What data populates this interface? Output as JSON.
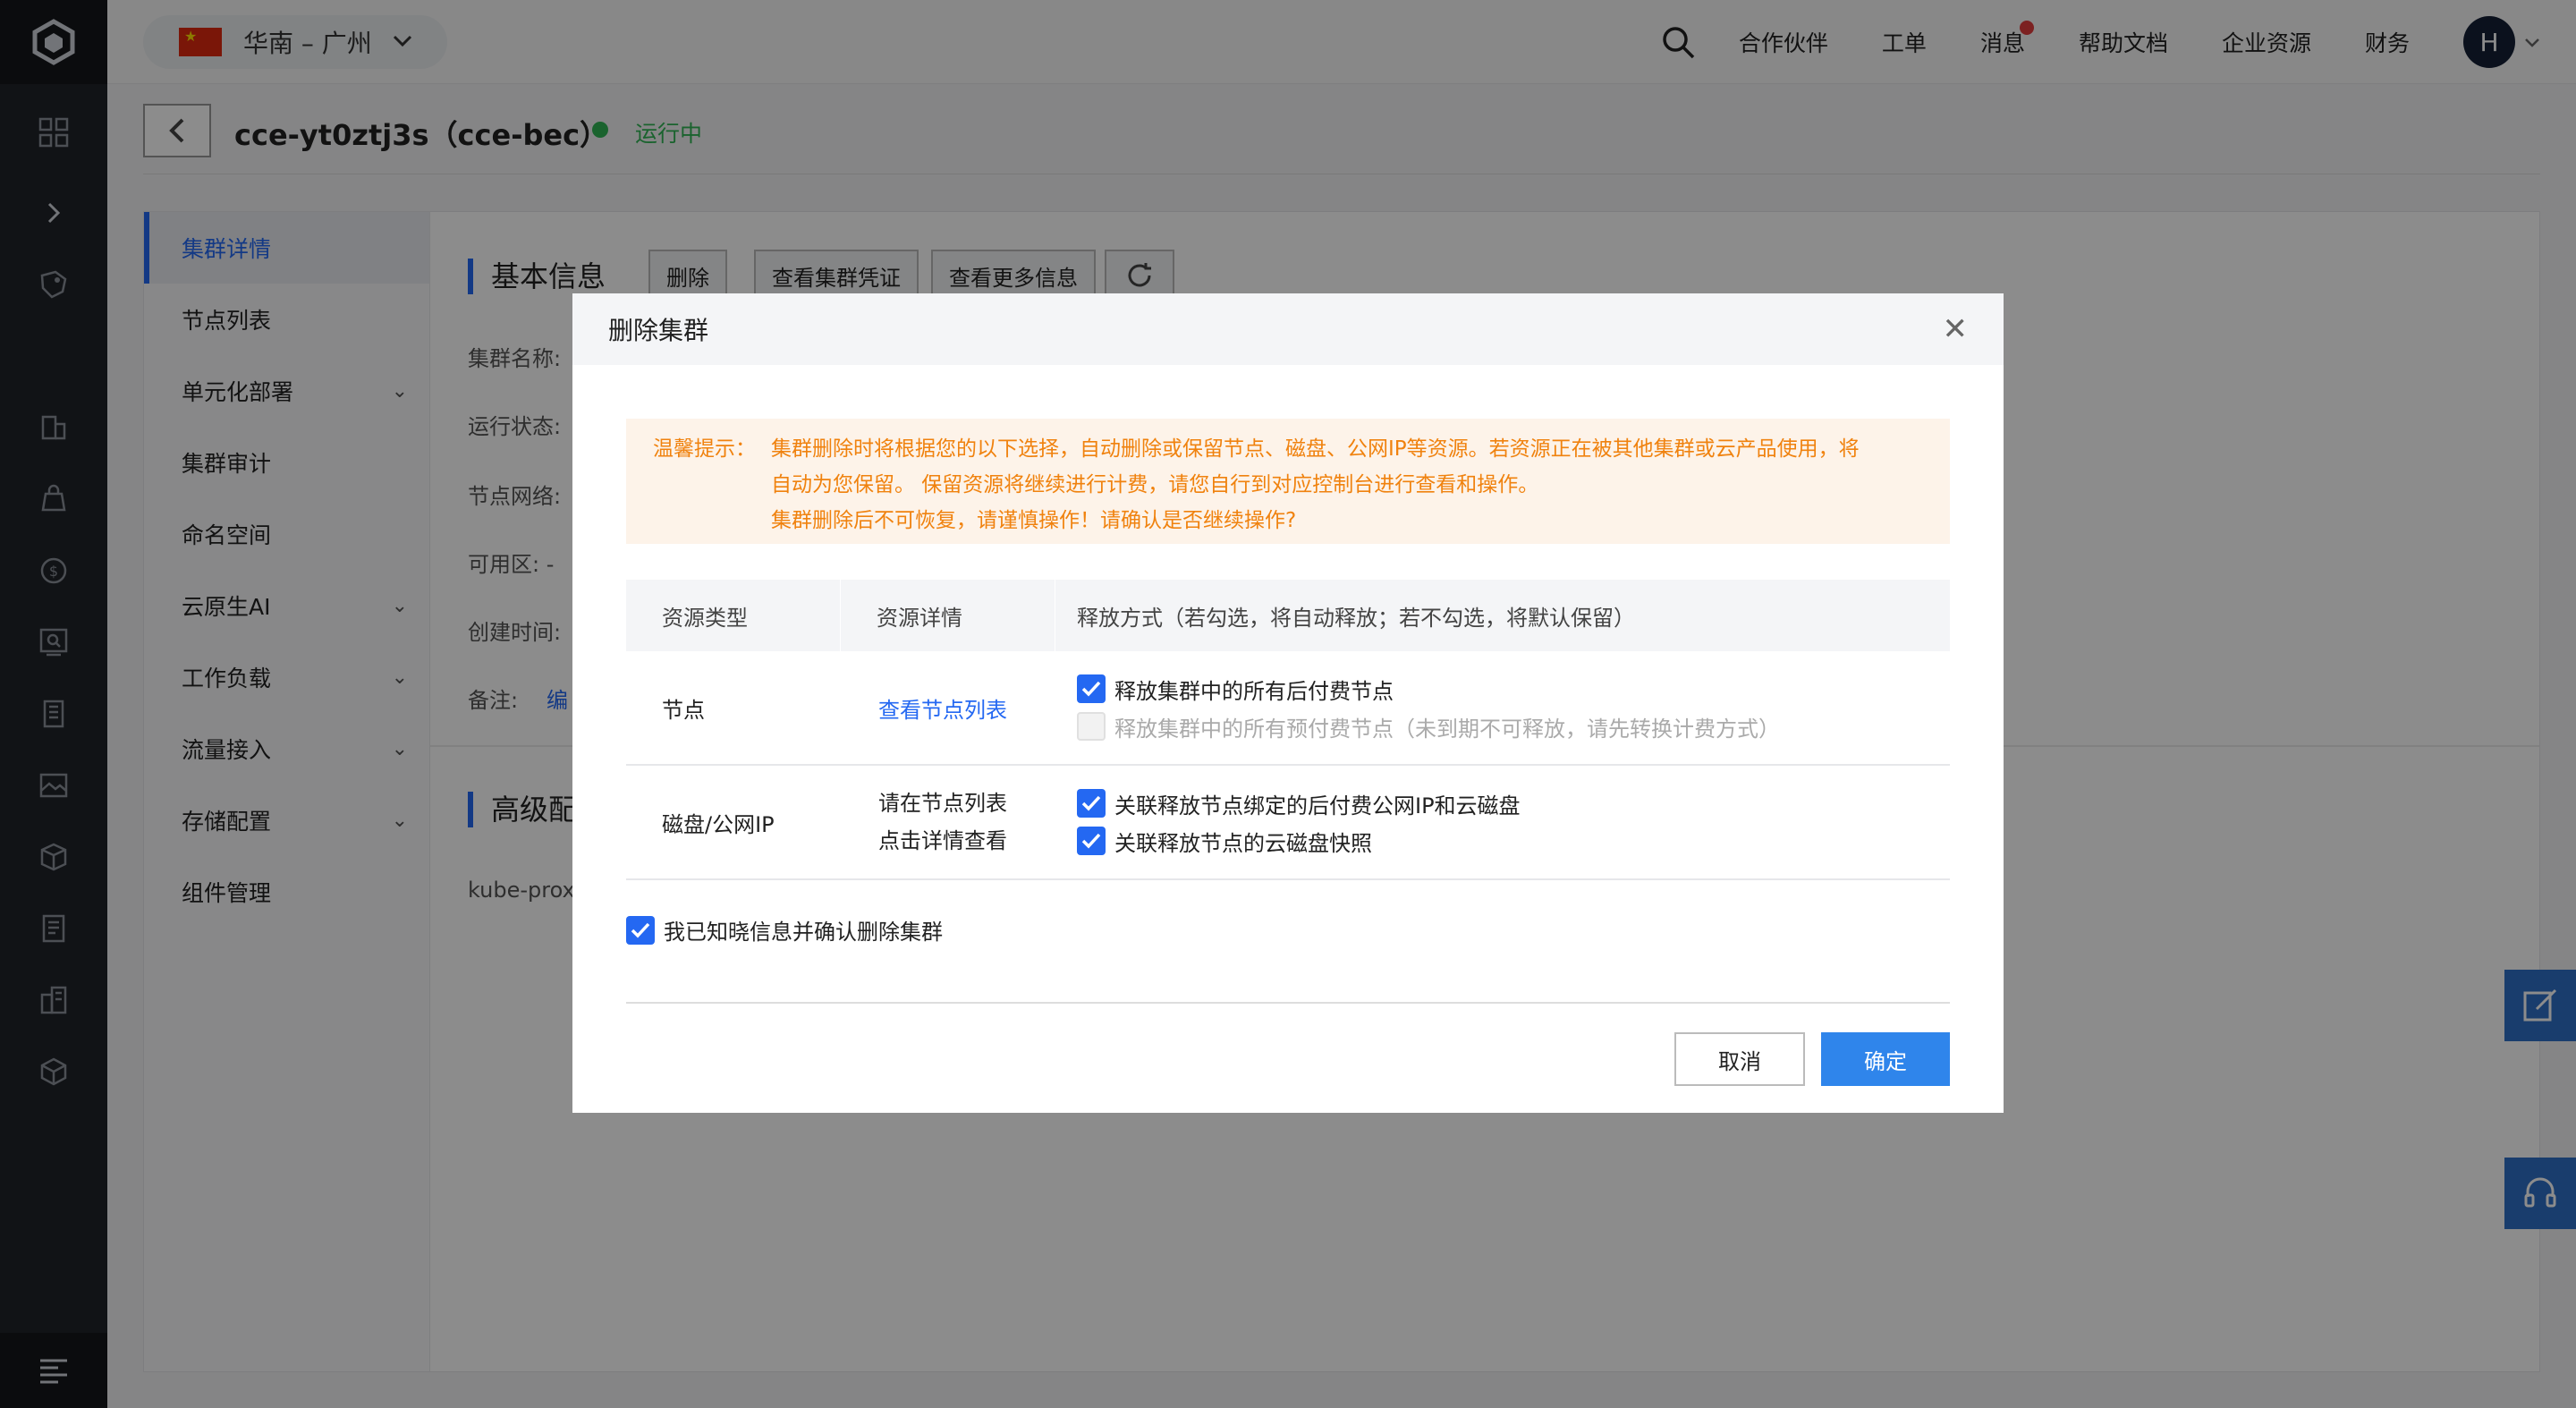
{
  "topbar": {
    "region": "华南 – 广州",
    "nav_items": [
      "合作伙伴",
      "工单",
      "消息",
      "帮助文档",
      "企业资源",
      "财务"
    ],
    "avatar_letter": "H"
  },
  "header": {
    "cluster_title": "cce-yt0ztj3s（cce-bec）",
    "status": "运行中"
  },
  "subnav": {
    "items": [
      {
        "label": "集群详情",
        "active": true,
        "expandable": false
      },
      {
        "label": "节点列表",
        "active": false,
        "expandable": false
      },
      {
        "label": "单元化部署",
        "active": false,
        "expandable": true
      },
      {
        "label": "集群审计",
        "active": false,
        "expandable": false
      },
      {
        "label": "命名空间",
        "active": false,
        "expandable": false
      },
      {
        "label": "云原生AI",
        "active": false,
        "expandable": true
      },
      {
        "label": "工作负载",
        "active": false,
        "expandable": true
      },
      {
        "label": "流量接入",
        "active": false,
        "expandable": true
      },
      {
        "label": "存储配置",
        "active": false,
        "expandable": true
      },
      {
        "label": "组件管理",
        "active": false,
        "expandable": false
      }
    ]
  },
  "basic_info": {
    "title": "基本信息",
    "buttons": [
      "删除",
      "查看集群凭证",
      "查看更多信息"
    ],
    "labels": [
      "集群名称:",
      "运行状态:",
      "节点网络:",
      "可用区: -",
      "创建时间:",
      "备注:"
    ],
    "remark_link": "编"
  },
  "advanced": {
    "title": "高级配",
    "row_label": "kube-prox"
  },
  "dialog": {
    "title": "删除集群",
    "notice_label": "温馨提示：",
    "notice_lines": [
      "集群删除时将根据您的以下选择，自动删除或保留节点、磁盘、公网IP等资源。若资源正在被其他集群或云产品使用，将",
      "自动为您保留。 保留资源将继续进行计费，请您自行到对应控制台进行查看和操作。",
      "集群删除后不可恢复，请谨慎操作！请确认是否继续操作?"
    ],
    "table_headers": [
      "资源类型",
      "资源详情",
      "释放方式（若勾选，将自动释放；若不勾选，将默认保留）"
    ],
    "rows": [
      {
        "type": "节点",
        "detail": "查看节点列表",
        "options": [
          {
            "label": "释放集群中的所有后付费节点",
            "checked": true,
            "disabled": false
          },
          {
            "label": "释放集群中的所有预付费节点（未到期不可释放，请先转换计费方式）",
            "checked": false,
            "disabled": true
          }
        ]
      },
      {
        "type": "磁盘/公网IP",
        "detail_lines": [
          "请在节点列表",
          "点击详情查看"
        ],
        "options": [
          {
            "label": "关联释放节点绑定的后付费公网IP和云磁盘",
            "checked": true,
            "disabled": false
          },
          {
            "label": "关联释放节点的云磁盘快照",
            "checked": true,
            "disabled": false
          }
        ]
      }
    ],
    "confirm_label": "我已知晓信息并确认删除集群",
    "cancel_label": "取消",
    "ok_label": "确定"
  },
  "colors": {
    "accent": "#2468f2",
    "primary_button": "#2f85eb",
    "warning_text": "#f0820e",
    "warning_bg": "#fdf3e9",
    "status_green": "#31b454",
    "rail_bg": "#1f2329"
  }
}
